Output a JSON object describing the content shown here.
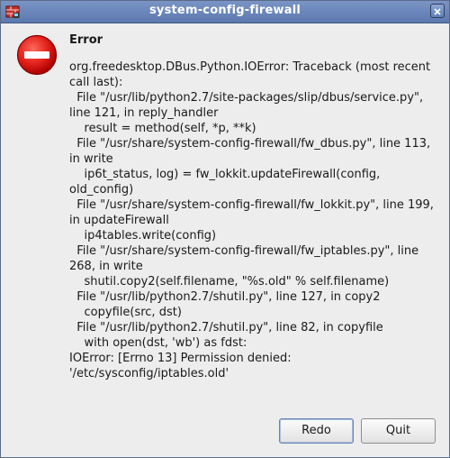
{
  "window": {
    "title": "system-config-firewall",
    "app_icon": "firewall-icon",
    "close_icon": "close-icon"
  },
  "dialog": {
    "icon": "error-icon",
    "heading": "Error",
    "message": "org.freedesktop.DBus.Python.IOError: Traceback (most recent call last):\n  File \"/usr/lib/python2.7/site-packages/slip/dbus/service.py\", line 121, in reply_handler\n    result = method(self, *p, **k)\n  File \"/usr/share/system-config-firewall/fw_dbus.py\", line 113, in write\n    ip6t_status, log) = fw_lokkit.updateFirewall(config, old_config)\n  File \"/usr/share/system-config-firewall/fw_lokkit.py\", line 199, in updateFirewall\n    ip4tables.write(config)\n  File \"/usr/share/system-config-firewall/fw_iptables.py\", line 268, in write\n    shutil.copy2(self.filename, \"%s.old\" % self.filename)\n  File \"/usr/lib/python2.7/shutil.py\", line 127, in copy2\n    copyfile(src, dst)\n  File \"/usr/lib/python2.7/shutil.py\", line 82, in copyfile\n    with open(dst, 'wb') as fdst:\nIOError: [Errno 13] Permission denied: '/etc/sysconfig/iptables.old'"
  },
  "buttons": {
    "redo_label": "Redo",
    "quit_label": "Quit"
  },
  "colors": {
    "titlebar": "#6a86ba",
    "error_red": "#d40000",
    "background": "#ededed"
  }
}
